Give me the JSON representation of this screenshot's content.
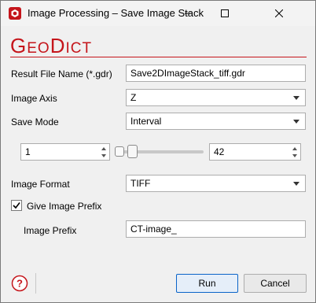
{
  "window": {
    "title": "Image Processing – Save Image Stack",
    "controls": {
      "minimize": "minimize",
      "maximize": "maximize",
      "close": "close"
    }
  },
  "brand": {
    "logo_g": "G",
    "logo_eo": "EO",
    "logo_d": "D",
    "logo_ict": "ICT",
    "color": "#c5151b"
  },
  "form": {
    "result_file_label": "Result File Name (*.gdr)",
    "result_file_value": "Save2DImageStack_tiff.gdr",
    "image_axis_label": "Image Axis",
    "image_axis_value": "Z",
    "save_mode_label": "Save Mode",
    "save_mode_value": "Interval",
    "interval_start": "1",
    "interval_end": "42",
    "image_format_label": "Image Format",
    "image_format_value": "TIFF",
    "give_prefix_label": "Give Image Prefix",
    "give_prefix_checked": true,
    "image_prefix_label": "Image Prefix",
    "image_prefix_value": "CT-image_"
  },
  "footer": {
    "help_icon": "?",
    "run_label": "Run",
    "cancel_label": "Cancel",
    "accent": "#0a64c8"
  }
}
